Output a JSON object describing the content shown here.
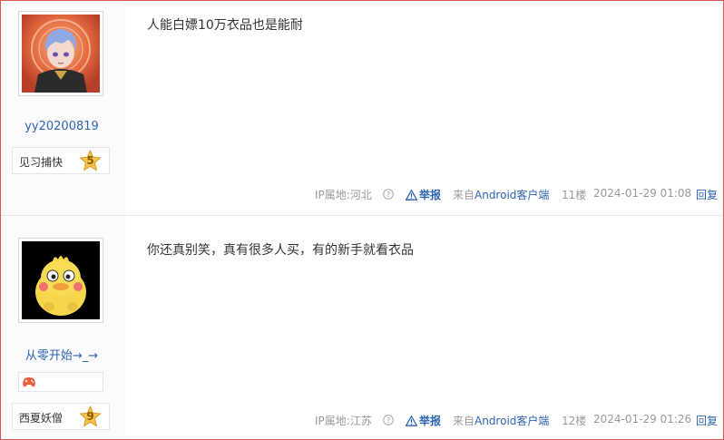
{
  "posts": [
    {
      "username": "yy20200819",
      "badge_title": "见习捕快",
      "badge_level": "5",
      "content": "人能白嫖10万衣品也是能耐",
      "ip": "IP属地:河北",
      "report_label": "举报",
      "source_prefix": "来自",
      "source_link": "Android客户端",
      "floor": "11楼",
      "time": "2024-01-29 01:08",
      "reply_label": "回复"
    },
    {
      "username": "从零开始→_→",
      "badge_title": "西夏妖僧",
      "badge_level": "9",
      "content": "你还真别笑，真有很多人买，有的新手就看衣品",
      "ip": "IP属地:江苏",
      "report_label": "举报",
      "source_prefix": "来自",
      "source_link": "Android客户端",
      "floor": "12楼",
      "time": "2024-01-29 01:26",
      "reply_label": "回复"
    }
  ],
  "icons": {
    "help": "question-circle-icon",
    "report": "warning-triangle-icon",
    "level_badge": "star-badge-icon",
    "game": "gamepad-icon"
  },
  "colors": {
    "link": "#2d64b3",
    "meta": "#999999",
    "border": "#d9534f"
  }
}
